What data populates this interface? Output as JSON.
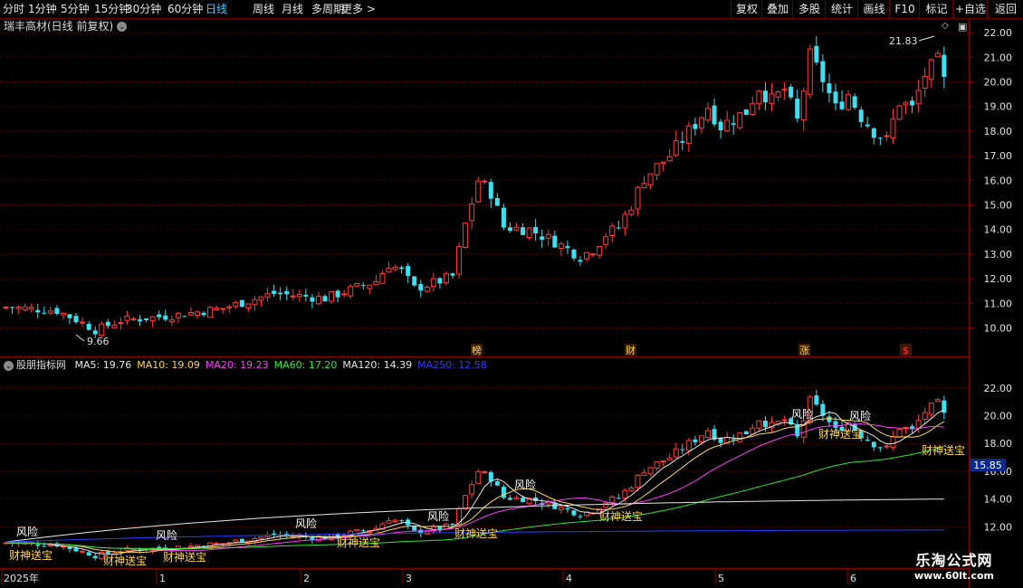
{
  "toolbar": {
    "periods": [
      "分时",
      "1分钟",
      "5分钟",
      "15分钟",
      "30分钟",
      "60分钟",
      "日线",
      "周线",
      "月线",
      "多周期",
      "更多 >"
    ],
    "active": "日线",
    "right_buttons": [
      "复权",
      "叠加",
      "多股",
      "统计",
      "画线",
      "F10",
      "标记",
      "+自选",
      "返回"
    ]
  },
  "main_chart": {
    "title": "瑞丰高材(日线 前复权)",
    "y_ticks": [
      "22.00",
      "21.00",
      "20.00",
      "19.00",
      "18.00",
      "17.00",
      "16.00",
      "15.00",
      "14.00",
      "13.00",
      "12.00",
      "11.00",
      "10.00"
    ],
    "high_label": "21.83",
    "low_label": "9.66",
    "event_markers": [
      "榜",
      "财",
      "涨",
      "$"
    ]
  },
  "indicator": {
    "name": "股朋指标网",
    "ma_labels": [
      {
        "text": "MA5: 19.76",
        "color": "#e8e8e8"
      },
      {
        "text": "MA10: 19.09",
        "color": "#ffd84a"
      },
      {
        "text": "MA20: 19.23",
        "color": "#ff3cff"
      },
      {
        "text": "MA60: 17.20",
        "color": "#2ee82e"
      },
      {
        "text": "MA120: 14.39",
        "color": "#e8e8e8"
      },
      {
        "text": "MA250: 12.58",
        "color": "#2a3cff"
      }
    ],
    "y_ticks": [
      "22.00",
      "20.00",
      "18.00",
      "16.00",
      "14.00",
      "12.00"
    ],
    "current_price": "15.85",
    "signal_risk": "风险",
    "signal_buy": "财神送宝"
  },
  "x_axis": {
    "labels": [
      "2025年",
      "1",
      "2",
      "3",
      "4",
      "5",
      "6"
    ]
  },
  "watermark": {
    "line1": "乐淘公式网",
    "line2": "www.60lt.com"
  },
  "colors": {
    "up": "#ff3c3c",
    "down": "#3ee0f0",
    "grid": "#6a0000",
    "active": "#3ec8ff"
  }
}
